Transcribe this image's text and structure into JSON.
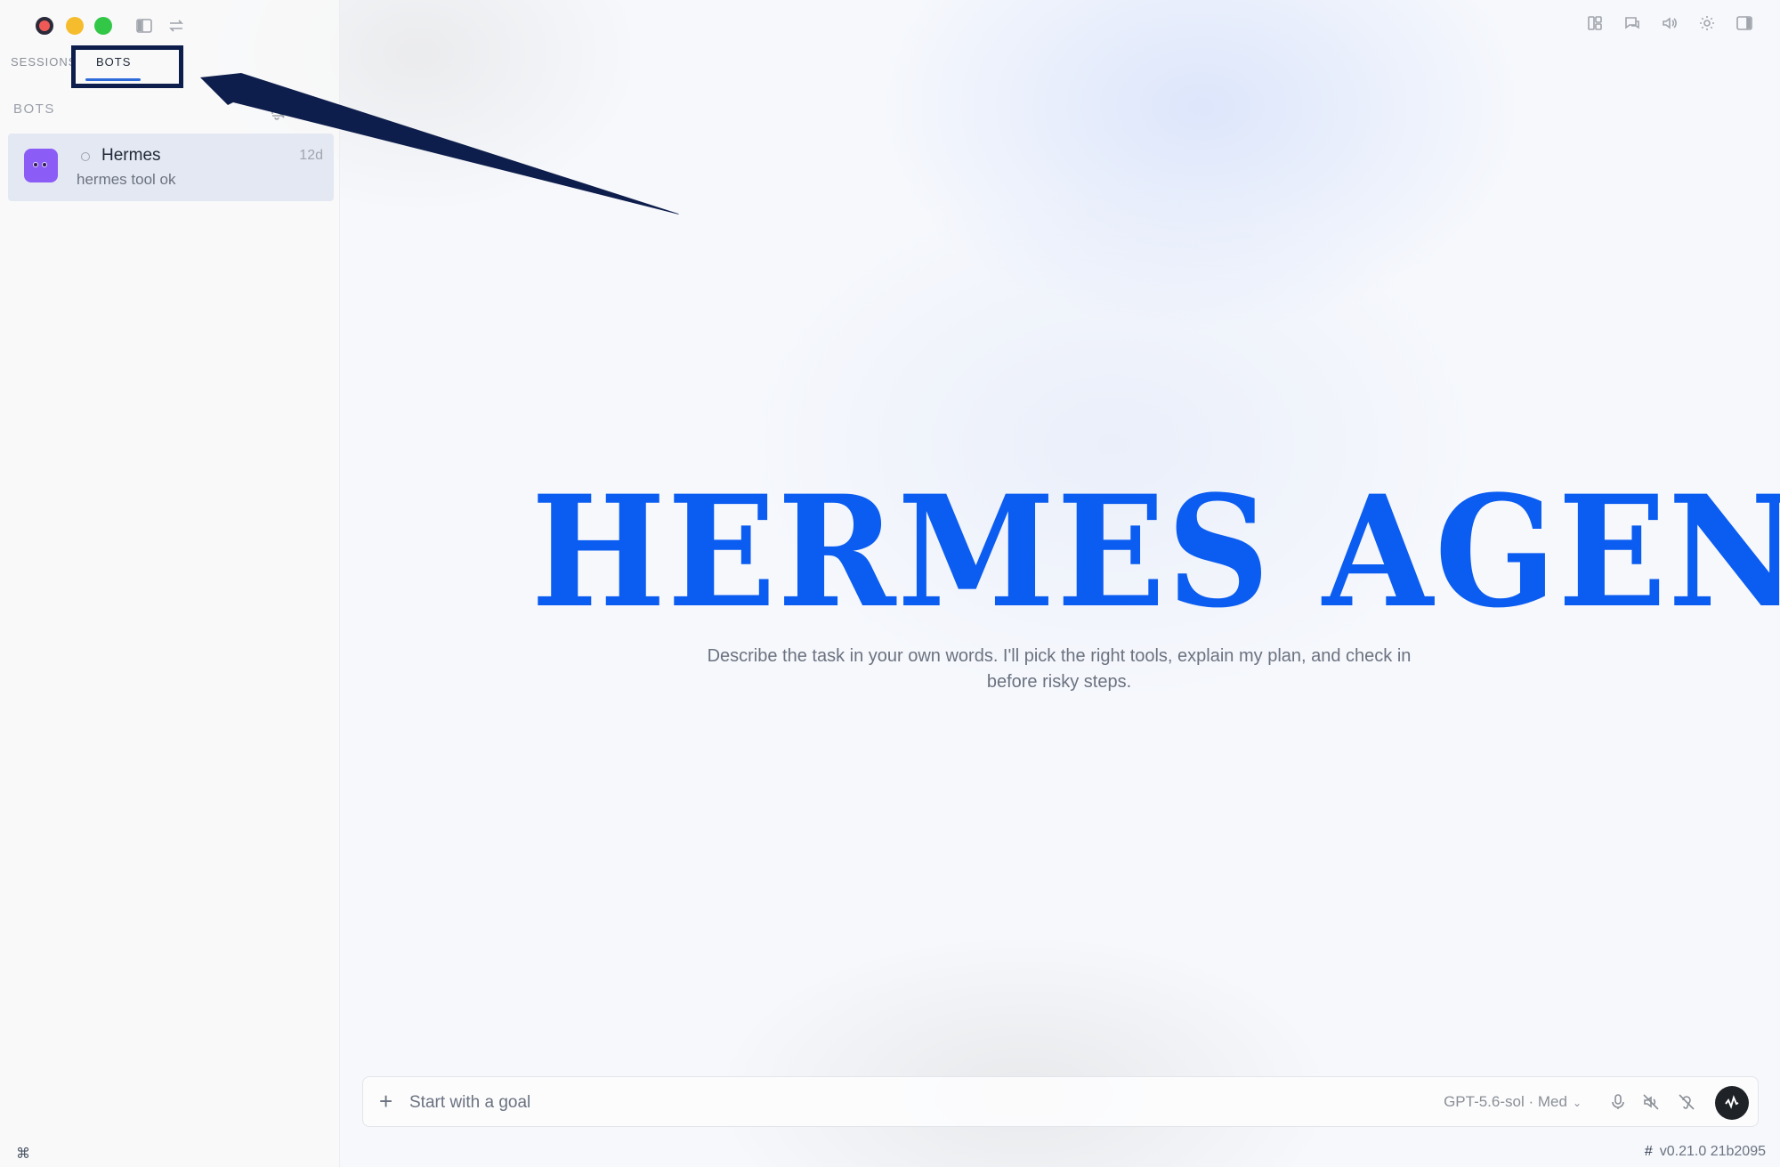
{
  "sidebar": {
    "tabs": [
      {
        "label": "SESSIONS"
      },
      {
        "label": "BOTS"
      }
    ],
    "section_label": "BOTS",
    "bots": [
      {
        "name": "Hermes",
        "preview": "hermes tool ok",
        "time": "12d",
        "avatar_color": "#8b5cf6"
      }
    ]
  },
  "main": {
    "hero_title": "HERMES AGENT",
    "tagline": "Describe the task in your own words. I'll pick the right tools, explain my plan, and check in before risky steps.",
    "composer": {
      "placeholder": "Start with a goal",
      "model": "GPT-5.6-sol · Med"
    }
  },
  "footer": {
    "version": "v0.21.0",
    "build": "21b2095"
  },
  "colors": {
    "accent": "#0b5cf0",
    "annotation": "#0e1e4c",
    "tab_underline": "#2f6bd8"
  },
  "icons": [
    "close-button",
    "minimize-button",
    "maximize-button",
    "sidebar-toggle-icon",
    "swap-icon",
    "layout-icon",
    "chat-icon",
    "volume-icon",
    "gear-icon",
    "panel-icon",
    "bell-off-icon",
    "plus-icon",
    "mic-icon",
    "volume-off-icon",
    "ear-off-icon",
    "waveform-icon",
    "command-icon"
  ]
}
